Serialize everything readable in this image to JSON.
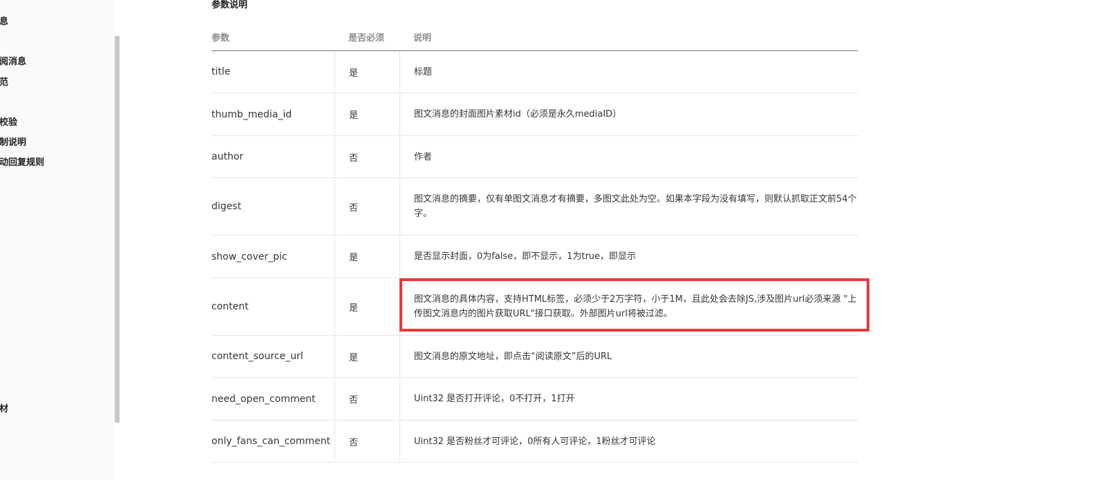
{
  "sidebar": {
    "items": [
      {
        "label": "消息"
      },
      {
        "label": "订阅消息"
      },
      {
        "label": "规范"
      },
      {
        "label": "明"
      },
      {
        "label": "则校验"
      },
      {
        "label": "限制说明"
      },
      {
        "label": "自动回复规则"
      },
      {
        "label": "素材"
      }
    ]
  },
  "section": {
    "title": "参数说明"
  },
  "table": {
    "headers": {
      "param": "参数",
      "required": "是否必须",
      "description": "说明"
    },
    "rows": [
      {
        "param": "title",
        "required": "是",
        "description": "标题"
      },
      {
        "param": "thumb_media_id",
        "required": "是",
        "description": "图文消息的封面图片素材id（必须是永久mediaID）"
      },
      {
        "param": "author",
        "required": "否",
        "description": "作者"
      },
      {
        "param": "digest",
        "required": "否",
        "description": "图文消息的摘要，仅有单图文消息才有摘要，多图文此处为空。如果本字段为没有填写，则默认抓取正文前54个字。"
      },
      {
        "param": "show_cover_pic",
        "required": "是",
        "description": "是否显示封面，0为false，即不显示，1为true，即显示"
      },
      {
        "param": "content",
        "required": "是",
        "description": "图文消息的具体内容，支持HTML标签，必须少于2万字符，小于1M，且此处会去除JS,涉及图片url必须来源 \"上传图文消息内的图片获取URL\"接口获取。外部图片url将被过滤。"
      },
      {
        "param": "content_source_url",
        "required": "是",
        "description": "图文消息的原文地址，即点击“阅读原文”后的URL"
      },
      {
        "param": "need_open_comment",
        "required": "否",
        "description": "Uint32 是否打开评论，0不打开，1打开"
      },
      {
        "param": "only_fans_can_comment",
        "required": "否",
        "description": "Uint32 是否粉丝才可评论，0所有人可评论，1粉丝才可评论"
      }
    ]
  },
  "highlight": {
    "color": "#e8393a",
    "target_row": "content"
  }
}
